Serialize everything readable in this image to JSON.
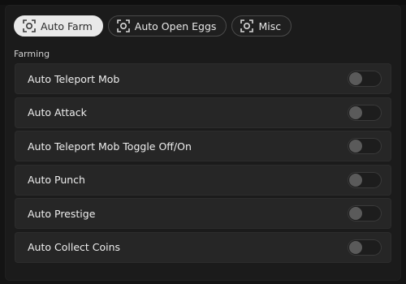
{
  "tabs": [
    {
      "label": "Auto Farm",
      "icon": "target-icon",
      "active": true
    },
    {
      "label": "Auto Open Eggs",
      "icon": "target-icon",
      "active": false
    },
    {
      "label": "Misc",
      "icon": "target-icon",
      "active": false
    }
  ],
  "section": {
    "title": "Farming"
  },
  "options": [
    {
      "label": "Auto Teleport Mob",
      "enabled": false
    },
    {
      "label": "Auto Attack",
      "enabled": false
    },
    {
      "label": "Auto Teleport Mob Toggle Off/On",
      "enabled": false
    },
    {
      "label": "Auto Punch",
      "enabled": false
    },
    {
      "label": "Auto Prestige",
      "enabled": false
    },
    {
      "label": "Auto Collect Coins",
      "enabled": false
    }
  ],
  "colors": {
    "background": "#141414",
    "panel": "#1b1b1b",
    "row": "#262626",
    "active_tab": "#e9e9e9",
    "toggle_off_knob": "#5a5a5a"
  }
}
